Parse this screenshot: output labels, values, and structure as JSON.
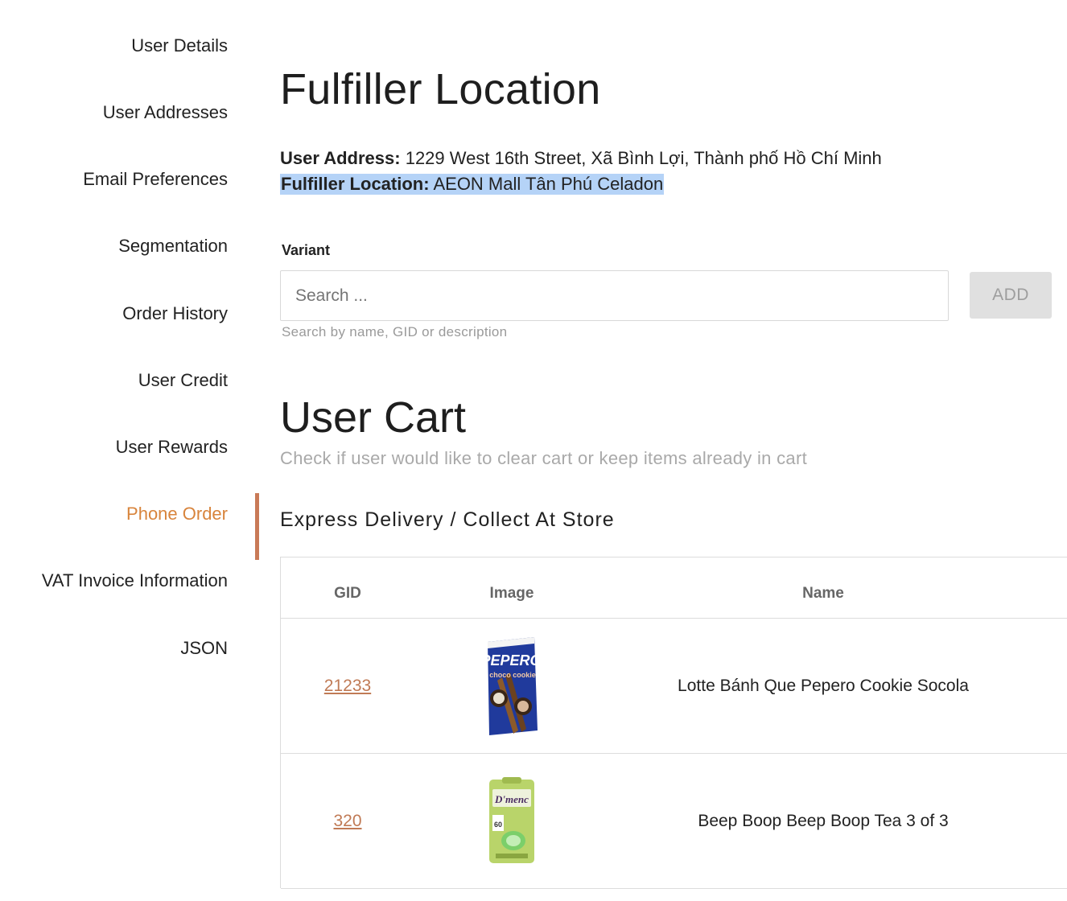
{
  "sidebar": {
    "items": [
      {
        "label": "User Details",
        "active": false
      },
      {
        "label": "User Addresses",
        "active": false
      },
      {
        "label": "Email Preferences",
        "active": false
      },
      {
        "label": "Segmentation",
        "active": false
      },
      {
        "label": "Order History",
        "active": false
      },
      {
        "label": "User Credit",
        "active": false
      },
      {
        "label": "User Rewards",
        "active": false
      },
      {
        "label": "Phone Order",
        "active": true
      },
      {
        "label": "VAT Invoice Information",
        "active": false
      },
      {
        "label": "JSON",
        "active": false
      }
    ],
    "accent_color": "#d8843c"
  },
  "header": {
    "title": "Fulfiller Location",
    "user_address_label": "User Address:",
    "user_address_value": "1229 West 16th Street, Xã Bình Lợi, Thành phố Hồ Chí Minh",
    "fulfiller_label": "Fulfiller Location:",
    "fulfiller_value": "AEON Mall Tân Phú Celadon"
  },
  "variant": {
    "label": "Variant",
    "placeholder": "Search ...",
    "value": "",
    "hint": "Search by name, GID or description",
    "add_label": "ADD"
  },
  "cart": {
    "title": "User Cart",
    "subtitle": "Check if user would like to clear cart or keep items already in cart",
    "section_title": "Express Delivery / Collect At Store",
    "columns": [
      "GID",
      "Image",
      "Name"
    ],
    "rows": [
      {
        "gid": "21233",
        "image_icon": "pepero-cookie-box-icon",
        "image_text": "PEPERO",
        "name": "Lotte Bánh Que Pepero Cookie Socola"
      },
      {
        "gid": "320",
        "image_icon": "dmenc-air-freshener-icon",
        "image_text": "D'menc",
        "name": "Beep Boop Beep Boop Tea 3 of 3"
      }
    ]
  }
}
